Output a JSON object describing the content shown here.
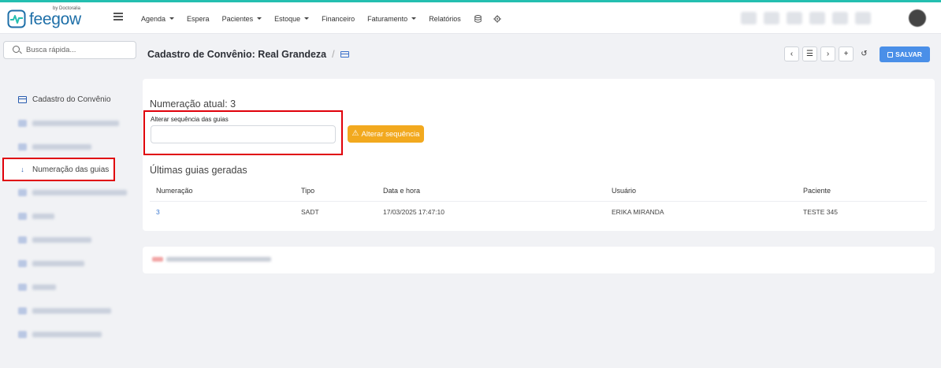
{
  "brand": {
    "name": "feegow",
    "by": "by Doctoralia",
    "accent": "#24bfb0",
    "brand_color": "#1e6fa8"
  },
  "nav": {
    "items": [
      {
        "label": "Agenda",
        "dropdown": true
      },
      {
        "label": "Espera",
        "dropdown": false
      },
      {
        "label": "Pacientes",
        "dropdown": true
      },
      {
        "label": "Estoque",
        "dropdown": true
      },
      {
        "label": "Financeiro",
        "dropdown": false
      },
      {
        "label": "Faturamento",
        "dropdown": true
      },
      {
        "label": "Relatórios",
        "dropdown": false
      }
    ],
    "icons": [
      "database-icon",
      "gear-icon"
    ]
  },
  "search": {
    "placeholder": "Busca rápida..."
  },
  "sidebar": {
    "items": [
      {
        "label": "Cadastro do Convênio",
        "icon": "card-icon",
        "state": "normal"
      },
      {
        "label": "",
        "state": "blurred"
      },
      {
        "label": "",
        "state": "blurred"
      },
      {
        "label": "Numeração das guias",
        "icon": "sort-icon",
        "state": "active"
      },
      {
        "label": "",
        "state": "blurred"
      },
      {
        "label": "",
        "state": "blurred"
      },
      {
        "label": "",
        "state": "blurred"
      },
      {
        "label": "",
        "state": "blurred"
      },
      {
        "label": "",
        "state": "blurred"
      },
      {
        "label": "",
        "state": "blurred"
      },
      {
        "label": "",
        "state": "blurred"
      }
    ]
  },
  "header": {
    "title": "Cadastro de Convênio: Real Grandeza",
    "separator": "/",
    "save_label": "SALVAR",
    "toolbar": {
      "prev": "‹",
      "list": "☰",
      "next": "›",
      "add": "+",
      "history": "↺"
    }
  },
  "form": {
    "current_label": "Numeração atual: 3",
    "sequence_label": "Alterar sequência das guias",
    "sequence_value": "",
    "alter_button": "Alterar sequência",
    "warn_glyph": "⚠"
  },
  "table": {
    "title": "Últimas guias geradas",
    "columns": [
      "Numeração",
      "Tipo",
      "Data e hora",
      "Usuário",
      "Paciente"
    ],
    "rows": [
      [
        "3",
        "SADT",
        "17/03/2025 17:47:10",
        "ERIKA MIRANDA",
        "TESTE 345"
      ]
    ]
  }
}
